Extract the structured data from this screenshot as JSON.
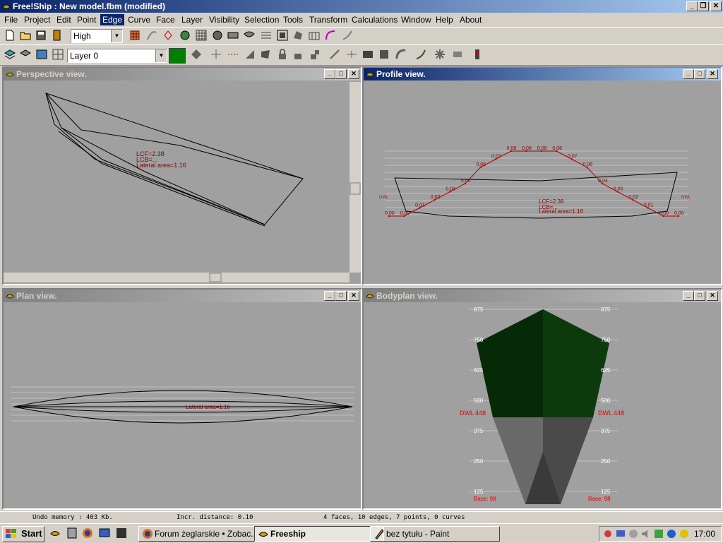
{
  "window": {
    "title": "Free!Ship  : New model.fbm (modified)"
  },
  "menu": [
    "File",
    "Project",
    "Edit",
    "Point",
    "Edge",
    "Curve",
    "Face",
    "Layer",
    "Visibility",
    "Selection",
    "Tools",
    "Transform",
    "Calculations",
    "Window",
    "Help",
    "About"
  ],
  "menu_active": "Edge",
  "toolbar": {
    "precision_value": "High",
    "layer_value": "Layer 0",
    "layer_color": "#008000"
  },
  "panes": {
    "perspective": {
      "title": "Perspective view.",
      "labels": [
        "LCF=2.38",
        "LCB=...",
        "Lateral area=1.16"
      ]
    },
    "profile": {
      "title": "Profile view.",
      "curve_labels": [
        "0.00",
        "0.00",
        "0.01",
        "0.02",
        "0.03",
        "0.04",
        "0.06",
        "0.07",
        "0.08",
        "0.08",
        "0.08",
        "0.08",
        "0.07",
        "0.06",
        "0.04",
        "0.03",
        "0.02",
        "0.01",
        "0.00",
        "0.00"
      ],
      "info_labels": [
        "LCF=2.38",
        "LCB=...",
        "Lateral area=1.16"
      ],
      "dwl": "DWL"
    },
    "plan": {
      "title": "Plan view.",
      "labels": [
        "Lateral area=1.16"
      ]
    },
    "bodyplan": {
      "title": "Bodyplan view.",
      "ticks": [
        "875",
        "750",
        "625",
        "500",
        "375",
        "250",
        "125"
      ],
      "dwl_left": "DWL 448",
      "dwl_right": "DWL 448",
      "base_left": "Base: 98",
      "base_right": "Base: 98"
    }
  },
  "statusbar": {
    "undo": "Undo memory : 403 Kb.",
    "incr": "Incr. distance: 0.10",
    "counts": "4 faces, 10 edges, 7 points, 0 curves"
  },
  "taskbar": {
    "start": "Start",
    "tasks": [
      "Forum żeglarskie • Zobac...",
      "Freeship",
      "bez tytułu - Paint"
    ],
    "clock": "17:00"
  },
  "colors": {
    "hull_green": "#0c3a0c",
    "hull_grey": "#5a5a5a",
    "curve_red": "#a00000",
    "title_blue": "#0a246a"
  }
}
